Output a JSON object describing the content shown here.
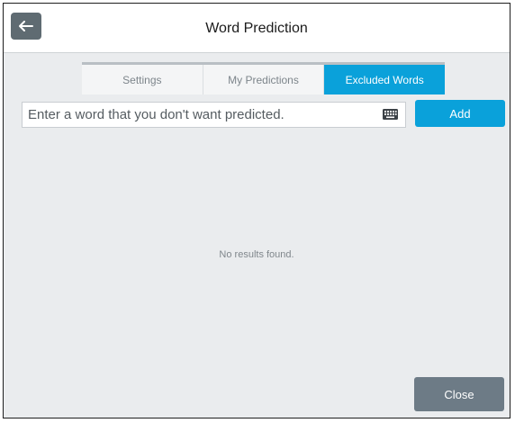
{
  "header": {
    "title": "Word Prediction",
    "back_icon": "arrow-left-icon"
  },
  "tabs": [
    {
      "label": "Settings",
      "active": false
    },
    {
      "label": "My Predictions",
      "active": false
    },
    {
      "label": "Excluded Words",
      "active": true
    }
  ],
  "entry": {
    "placeholder": "Enter a word that you don't want predicted.",
    "value": "",
    "keyboard_icon": "keyboard-icon",
    "add_label": "Add"
  },
  "results": {
    "empty_message": "No results found."
  },
  "footer": {
    "close_label": "Close"
  },
  "colors": {
    "accent": "#0aa1da",
    "close_button": "#6d7b86",
    "back_button": "#5f6b72",
    "background": "#eaecee"
  }
}
